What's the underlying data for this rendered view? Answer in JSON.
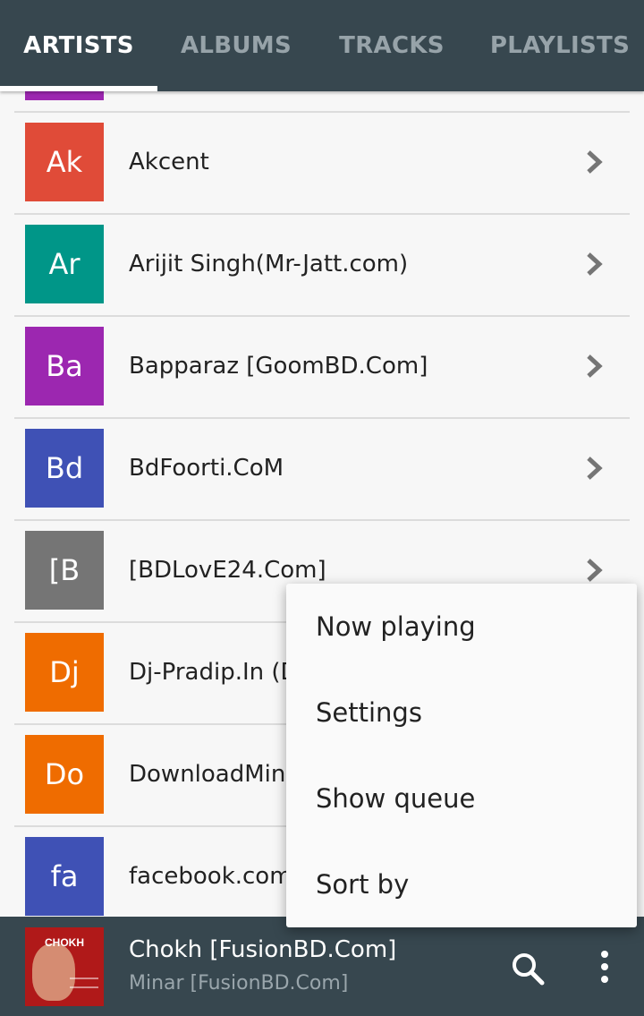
{
  "tabs": [
    {
      "label": "ARTISTS",
      "active": true
    },
    {
      "label": "ALBUMS",
      "active": false
    },
    {
      "label": "TRACKS",
      "active": false
    },
    {
      "label": "PLAYLISTS",
      "active": false
    }
  ],
  "artists": [
    {
      "initials": "Ak",
      "name": "Akcent",
      "color": "#e04b38"
    },
    {
      "initials": "Ar",
      "name": "Arijit Singh(Mr-Jatt.com)",
      "color": "#009688"
    },
    {
      "initials": "Ba",
      "name": "Bapparaz [GoomBD.Com]",
      "color": "#9c27b0"
    },
    {
      "initials": "Bd",
      "name": "BdFoorti.CoM",
      "color": "#3f51b5"
    },
    {
      "initials": "[B",
      "name": "[BDLovE24.Com]",
      "color": "#757575"
    },
    {
      "initials": "Dj",
      "name": "Dj-Pradip.In (D",
      "color": "#ef6c00"
    },
    {
      "initials": "Do",
      "name": "DownloadMing",
      "color": "#ef6c00"
    },
    {
      "initials": "fa",
      "name": "facebook.com",
      "color": "#3f51b5"
    }
  ],
  "partial_top_color": "#9c27b0",
  "now_playing": {
    "title": "Chokh [FusionBD.Com]",
    "artist": "Minar [FusionBD.Com]",
    "cover_text": "CHOKH",
    "search_icon": "search-icon",
    "more_icon": "more-vert-icon"
  },
  "menu": {
    "items": [
      {
        "label": "Now playing"
      },
      {
        "label": "Settings"
      },
      {
        "label": "Show queue"
      },
      {
        "label": "Sort by"
      }
    ]
  },
  "colors": {
    "toolbar": "#37474f",
    "tab_inactive": "#97a3a9",
    "tab_active": "#ffffff",
    "chevron": "#757575"
  }
}
